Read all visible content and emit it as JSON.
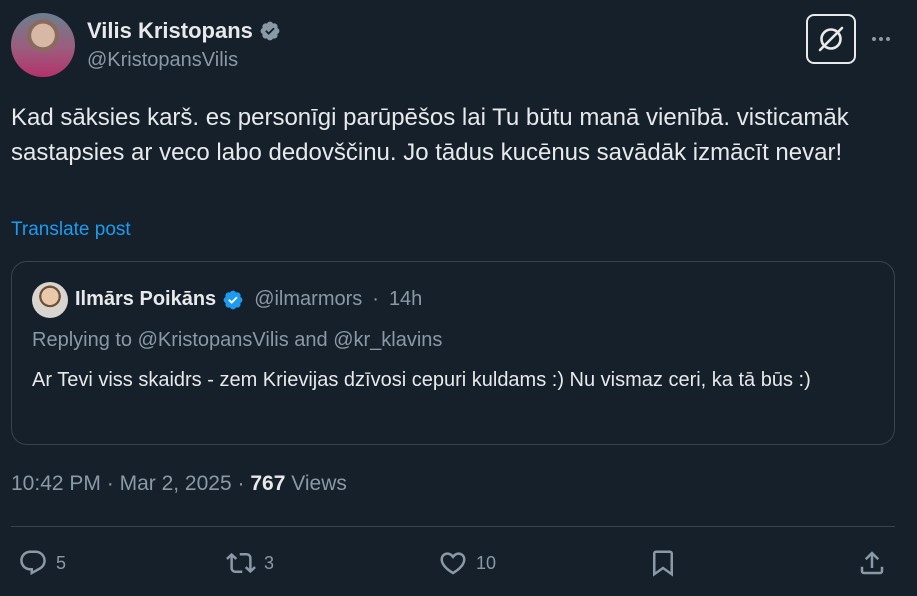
{
  "author": {
    "name": "Vilis Kristopans",
    "handle": "@KristopansVilis"
  },
  "post": {
    "text": "Kad sāksies karš. es personīgi parūpēšos lai Tu būtu manā vienībā. visticamāk sastapsies ar veco labo dedovščinu. Jo tādus kucēnus savādāk izmācīt nevar!",
    "translate_label": "Translate post"
  },
  "quote": {
    "name": "Ilmārs Poikāns",
    "handle": "@ilmarmors",
    "separator": "·",
    "time": "14h",
    "replying_to": "Replying to @KristopansVilis and @kr_klavins",
    "text": "Ar Tevi viss skaidrs - zem Krievijas dzīvosi cepuri kuldams :) Nu vismaz ceri, ka tā būs :)"
  },
  "meta": {
    "time": "10:42 PM",
    "date": "Mar 2, 2025",
    "views_count": "767",
    "views_label": "Views",
    "separator": "·"
  },
  "actions": {
    "replies": "5",
    "reposts": "3",
    "likes": "10"
  },
  "colors": {
    "background": "#15202b",
    "text": "#e7e9ea",
    "secondary": "#8b98a5",
    "accent": "#1d9bf0",
    "border": "#38444d"
  },
  "icons": [
    "verified-badge-icon",
    "grok-icon",
    "more-icon",
    "reply-icon",
    "repost-icon",
    "like-icon",
    "bookmark-icon",
    "share-icon"
  ]
}
